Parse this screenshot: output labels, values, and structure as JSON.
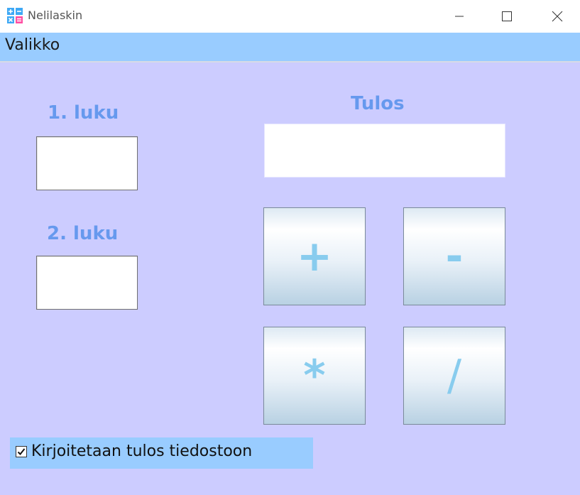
{
  "window": {
    "title": "Nelilaskin",
    "icon": "calculator-operators-icon",
    "controls": [
      "minimize-icon",
      "maximize-icon",
      "close-icon"
    ]
  },
  "menu": {
    "items": [
      {
        "label": "Valikko"
      }
    ]
  },
  "form": {
    "first_number_label": "1. luku",
    "first_number_value": "",
    "second_number_label": "2. luku",
    "second_number_value": "",
    "result_label": "Tulos",
    "result_value": ""
  },
  "operations": [
    {
      "label": "+"
    },
    {
      "label": "-"
    },
    {
      "label": "*"
    },
    {
      "label": "/"
    }
  ],
  "write_to_file": {
    "label": "Kirjoitetaan tulos tiedostoon",
    "checked": true
  },
  "colors": {
    "menubar": "#99ccff",
    "background": "#ccccff",
    "label": "#6699ee",
    "operator_glyph": "#88ccee"
  }
}
